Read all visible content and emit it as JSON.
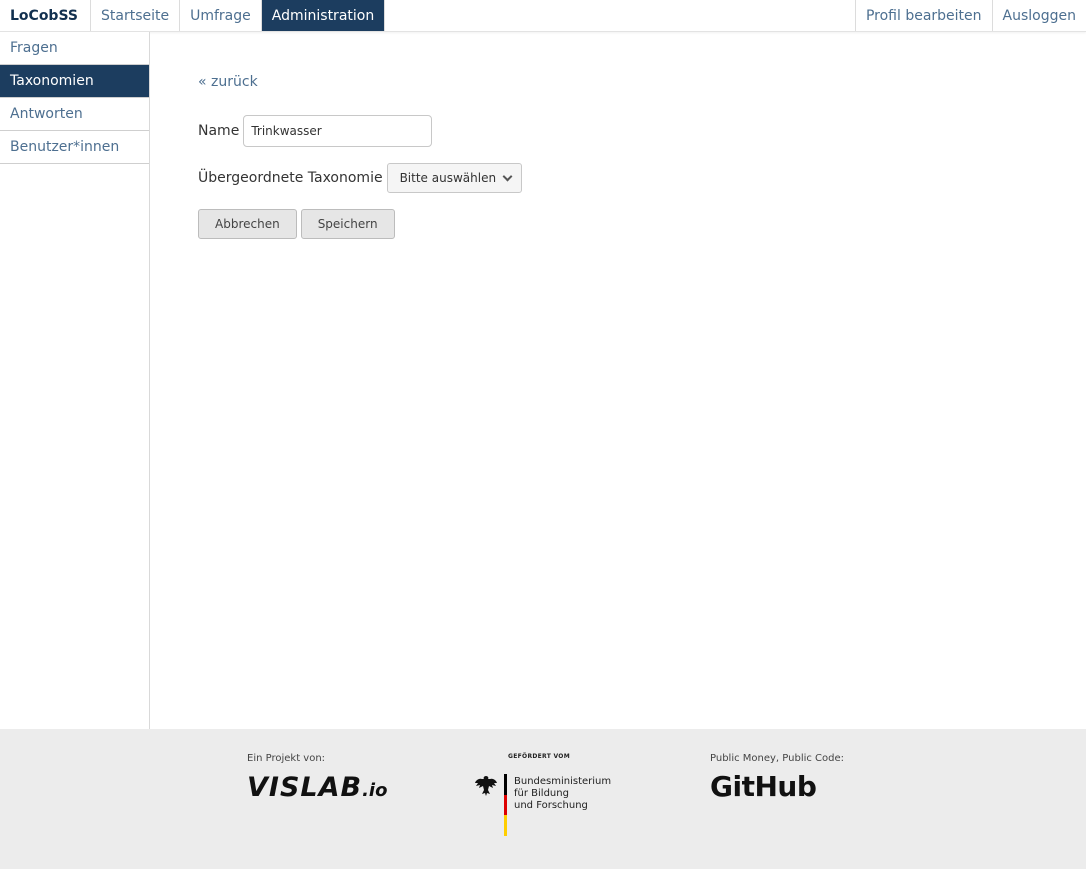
{
  "app": {
    "brand": "LoCobSS"
  },
  "nav": {
    "items": [
      {
        "label": "Startseite"
      },
      {
        "label": "Umfrage"
      },
      {
        "label": "Administration",
        "active": true
      }
    ],
    "right": [
      {
        "label": "Profil bearbeiten"
      },
      {
        "label": "Ausloggen"
      }
    ]
  },
  "sidebar": {
    "items": [
      {
        "label": "Fragen"
      },
      {
        "label": "Taxonomien",
        "active": true
      },
      {
        "label": "Antworten"
      },
      {
        "label": "Benutzer*innen"
      }
    ]
  },
  "form": {
    "back_label": "« zurück",
    "name_label": "Name",
    "name_value": "Trinkwasser",
    "parent_label": "Übergeordnete Taxonomie",
    "parent_select": "Bitte auswählen",
    "cancel_label": "Abbrechen",
    "save_label": "Speichern"
  },
  "footer": {
    "project_caption": "Ein Projekt von:",
    "vislab_logo": "VISLAB",
    "vislab_suffix": ".io",
    "funded_caption": "GEFÖRDERT VOM",
    "bmbf_line1": "Bundesministerium",
    "bmbf_line2": "für Bildung",
    "bmbf_line3": "und Forschung",
    "code_caption": "Public Money, Public Code:",
    "github_logo": "GitHub"
  },
  "colors": {
    "accent": "#1c3d5f",
    "link": "#4d6f90",
    "footer_bg": "#ececec"
  }
}
